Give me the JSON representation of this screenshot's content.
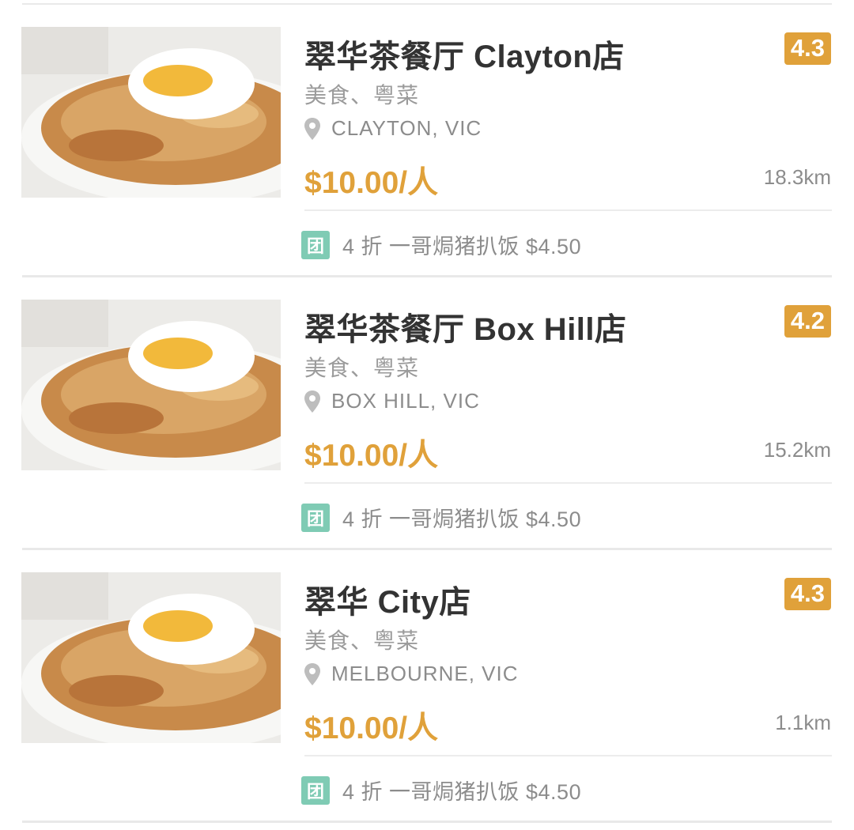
{
  "listings": [
    {
      "name_cn": "翠华茶餐厅",
      "name_en": "Clayton",
      "name_suffix": "店",
      "rating": "4.3",
      "category": "美食、粤菜",
      "location": "CLAYTON, VIC",
      "price": "$10.00/人",
      "distance": "18.3km",
      "deal_tag": "团",
      "deal_text": "4 折 一哥焗猪扒饭 $4.50"
    },
    {
      "name_cn": "翠华茶餐厅",
      "name_en": "Box Hill",
      "name_suffix": "店",
      "rating": "4.2",
      "category": "美食、粤菜",
      "location": "BOX HILL, VIC",
      "price": "$10.00/人",
      "distance": "15.2km",
      "deal_tag": "团",
      "deal_text": "4 折 一哥焗猪扒饭 $4.50"
    },
    {
      "name_cn": "翠华",
      "name_en": "City",
      "name_suffix": "店",
      "rating": "4.3",
      "category": "美食、粤菜",
      "location": "MELBOURNE, VIC",
      "price": "$10.00/人",
      "distance": "1.1km",
      "deal_tag": "团",
      "deal_text": "4 折 一哥焗猪扒饭 $4.50"
    }
  ],
  "icons": {
    "location": "location-pin-icon",
    "deal": "group-buy-tag-icon"
  },
  "colors": {
    "accent": "#e0a13a",
    "deal_tag": "#7fcbb4",
    "title": "#333333",
    "muted": "#8c8c8c"
  }
}
